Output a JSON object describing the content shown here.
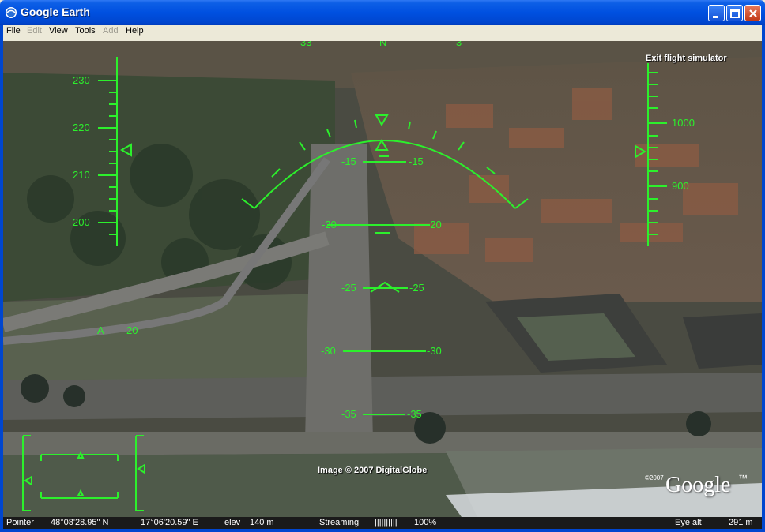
{
  "window": {
    "title": "Google Earth"
  },
  "menu": [
    {
      "label": "File",
      "enabled": true
    },
    {
      "label": "Edit",
      "enabled": false
    },
    {
      "label": "View",
      "enabled": true
    },
    {
      "label": "Tools",
      "enabled": true
    },
    {
      "label": "Add",
      "enabled": false
    },
    {
      "label": "Help",
      "enabled": true
    }
  ],
  "hud": {
    "exit_label": "Exit flight simulator",
    "speed_ticks": [
      "230",
      "220",
      "210",
      "200"
    ],
    "altitude_ticks": [
      "1000",
      "900"
    ],
    "heading_ticks": [
      "33",
      "N",
      "3"
    ],
    "pitch_ladder": [
      "-15",
      "-20",
      "-25",
      "-30",
      "-35"
    ],
    "mode_letter": "A",
    "mode_value": "20",
    "color": "#2cf02c"
  },
  "imagery_credit": "Image © 2007 DigitalGlobe",
  "logo": {
    "year": "©2007",
    "brand": "Google",
    "tm": "™"
  },
  "status": {
    "pointer_label": "Pointer",
    "lat": "48°08'28.95\" N",
    "lon": "17°06'20.59\" E",
    "elev_label": "elev",
    "elev_value": "140 m",
    "streaming_label": "Streaming",
    "streaming_bars": "||||||||||",
    "streaming_pct": "100%",
    "eye_alt_label": "Eye alt",
    "eye_alt_value": "291 m"
  }
}
